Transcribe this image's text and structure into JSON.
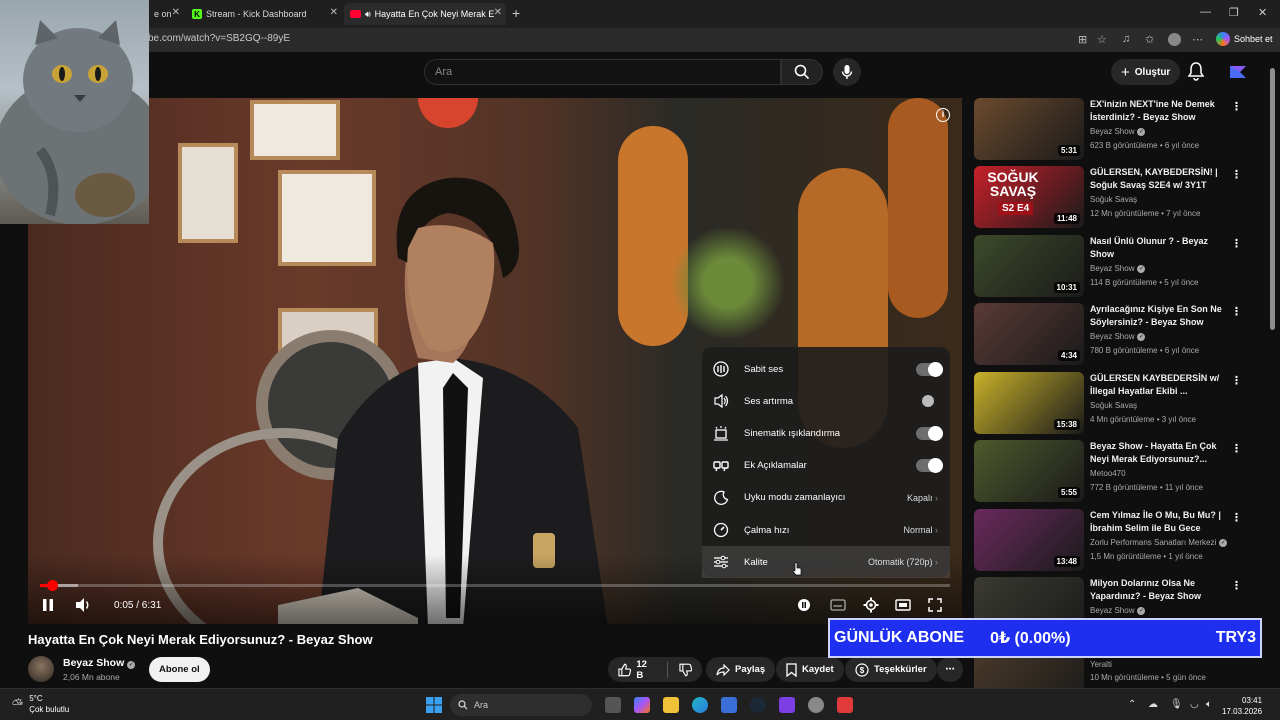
{
  "browser": {
    "tabs": [
      {
        "label": "e on"
      },
      {
        "label": "Stream - Kick Dashboard"
      },
      {
        "label": "Hayatta En Çok Neyi Merak E"
      }
    ],
    "url": "be.com/watch?v=SB2GQ--89yE",
    "sohbet_label": "Sohbet et"
  },
  "header": {
    "search_placeholder": "Ara",
    "create_label": "Oluştur"
  },
  "player": {
    "time": "0:05 / 6:31",
    "progress_fraction": 0.013,
    "settings": {
      "rows": [
        {
          "label": "Sabit ses",
          "icon": "stable-volume-icon",
          "toggle": "on"
        },
        {
          "label": "Ses artırma",
          "icon": "volume-boost-icon",
          "toggle": "off"
        },
        {
          "label": "Sinematik ışıklandırma",
          "icon": "ambient-mode-icon",
          "toggle": "on"
        },
        {
          "label": "Ek Açıklamalar",
          "icon": "annotations-icon",
          "toggle": "on"
        },
        {
          "label": "Uyku modu zamanlayıcı",
          "icon": "sleep-timer-icon",
          "value": "Kapalı"
        },
        {
          "label": "Çalma hızı",
          "icon": "playback-speed-icon",
          "value": "Normal"
        },
        {
          "label": "Kalite",
          "icon": "quality-icon",
          "value": "Otomatik (720p)"
        }
      ]
    }
  },
  "video": {
    "title": "Hayatta En Çok Neyi Merak Ediyorsunuz? - Beyaz Show",
    "channel": "Beyaz Show",
    "subscribers": "2,06 Mn abone",
    "subscribe_label": "Abone ol",
    "likes": "12 B",
    "share_label": "Paylaş",
    "save_label": "Kaydet",
    "thanks_label": "Teşekkürler"
  },
  "recommendations": [
    {
      "title": "EX'inizin NEXT'ine Ne Demek İsterdiniz? - Beyaz Show",
      "channel": "Beyaz Show",
      "meta": "623 B görüntüleme • 6 yıl önce",
      "duration": "5:31",
      "thumb_color": "#6b4a2e"
    },
    {
      "title": "GÜLERSEN, KAYBEDERSİN! | Soğuk Savaş S2E4 w/ 3Y1T",
      "channel": "Soğuk Savaş",
      "meta": "12 Mn görüntüleme • 7 yıl önce",
      "duration": "11:48",
      "thumb_color": "#c8202a",
      "thumb_text": "SOĞUK SAVAŞ",
      "thumb_sub": "S2 E4"
    },
    {
      "title": "Nasıl Ünlü Olunur ? - Beyaz Show",
      "channel": "Beyaz Show",
      "meta": "114 B görüntüleme • 5 yıl önce",
      "duration": "10:31",
      "thumb_color": "#3d4a2a"
    },
    {
      "title": "Ayrılacağınız Kişiye En Son Ne Söylersiniz? - Beyaz Show",
      "channel": "Beyaz Show",
      "meta": "780 B görüntüleme • 6 yıl önce",
      "duration": "4:34",
      "thumb_color": "#5a3a36"
    },
    {
      "title": "GÜLERSEN KAYBEDERSİN w/ İllegal Hayatlar Ekibi ...",
      "channel": "Soğuk Savaş",
      "meta": "4 Mn görüntüleme • 3 yıl önce",
      "duration": "15:38",
      "thumb_color": "#c9b22a"
    },
    {
      "title": "Beyaz Show - Hayatta En Çok Neyi Merak Ediyorsunuz?...",
      "channel": "Metoo470",
      "meta": "772 B görüntüleme • 11 yıl önce",
      "duration": "5:55",
      "thumb_color": "#4d5a2c"
    },
    {
      "title": "Cem Yılmaz İle O Mu, Bu Mu? | İbrahim Selim ile Bu Gece",
      "channel": "Zorlu Performans Sanatları Merkezi",
      "meta": "1,5 Mn görüntüleme • 1 yıl önce",
      "duration": "13:48",
      "thumb_color": "#6a2a5e"
    },
    {
      "title": "Milyon Dolarınız Olsa Ne Yapardınız? - Beyaz Show",
      "channel": "Beyaz Show",
      "meta": "",
      "duration": "",
      "thumb_color": "#3a3a32"
    },
    {
      "title": "",
      "channel": "Yeralti",
      "meta": "10 Mn görüntüleme • 5 gün önce",
      "duration": "",
      "thumb_color": "#4a3a2a"
    }
  ],
  "ticker": {
    "label": "GÜNLÜK ABONE",
    "value": "0₺ (0.00%)",
    "code": "TRY3"
  },
  "taskbar": {
    "temp": "5°C",
    "weather": "Çok bulutlu",
    "search": "Ara",
    "time": "03:41",
    "date": "17.03.2026"
  },
  "colors": {
    "accent_red": "#ff0000",
    "ticker_blue": "#1f2ff0"
  }
}
